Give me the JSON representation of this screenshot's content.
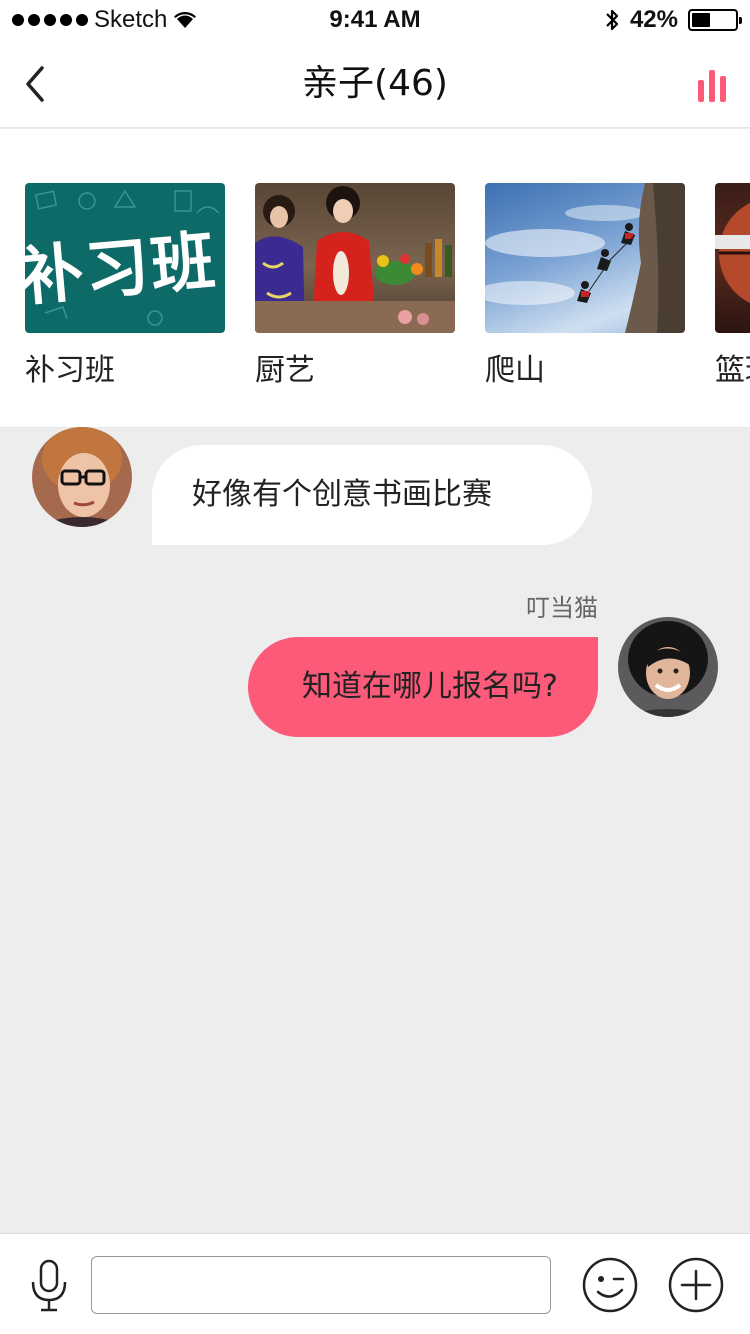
{
  "status_bar": {
    "carrier": "Sketch",
    "time": "9:41 AM",
    "battery_percent_text": "42%",
    "battery_level": 0.42,
    "icons": [
      "signal-dots-icon",
      "wifi-icon",
      "bluetooth-icon",
      "battery-icon"
    ]
  },
  "nav": {
    "title": "亲子(46)",
    "back_icon": "chevron-left-icon",
    "stats_icon": "bar-chart-icon",
    "accent_color": "#fb5a79"
  },
  "categories": [
    {
      "label": "补习班",
      "thumb_text": "补习班"
    },
    {
      "label": "厨艺"
    },
    {
      "label": "爬山"
    },
    {
      "label": "篮球"
    }
  ],
  "chat": {
    "messages": [
      {
        "direction": "incoming",
        "text": "好像有个创意书画比赛"
      },
      {
        "direction": "outgoing",
        "sender": "叮当猫",
        "text": "知道在哪儿报名吗?"
      }
    ],
    "outgoing_bubble_color": "#fb5a79",
    "incoming_bubble_color": "#ffffff"
  },
  "input_bar": {
    "value": "",
    "placeholder": "",
    "icons": [
      "microphone-icon",
      "emoji-icon",
      "plus-icon"
    ]
  }
}
